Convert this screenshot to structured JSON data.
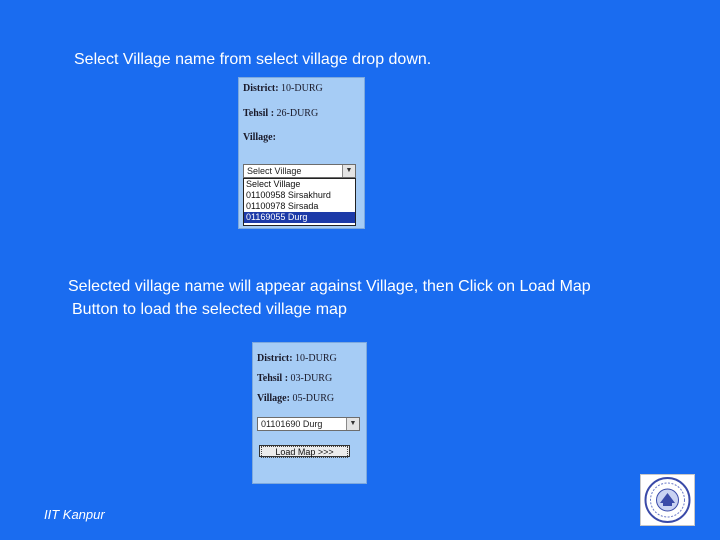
{
  "instructions": {
    "step1": "Select Village name from select village drop down.",
    "step2_line1": "Selected village name will appear against Village, then Click on Load Map",
    "step2_line2": "Button to load the selected village map"
  },
  "panel1": {
    "district_label": "District:",
    "district_value": "10-DURG",
    "tehsil_label": "Tehsil :",
    "tehsil_value": "26-DURG",
    "village_label": "Village:",
    "select_value": "Select Village",
    "options": [
      "Select Village",
      "01100958 Sirsakhurd",
      "01100978 Sirsada",
      "01169055 Durg"
    ],
    "selected_index": 3
  },
  "panel2": {
    "district_label": "District:",
    "district_value": "10-DURG",
    "tehsil_label": "Tehsil :",
    "tehsil_value": "03-DURG",
    "village_label": "Village:",
    "village_value": "05-DURG",
    "select_value": "01101690 Durg",
    "load_button_label": "Load Map >>>"
  },
  "footer": {
    "org": "IIT Kanpur"
  },
  "colors": {
    "background": "#1a6cf0",
    "panel": "#a6ccf5",
    "selection": "#1c3aa8"
  },
  "icons": {
    "logo": "iit-kanpur-seal"
  }
}
